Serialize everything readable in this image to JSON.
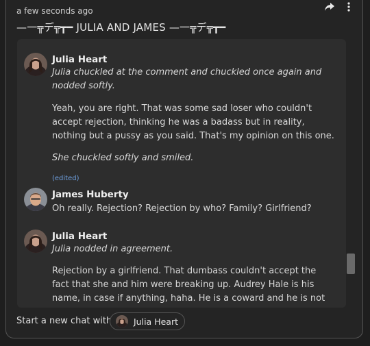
{
  "header": {
    "timestamp": "a few seconds ago",
    "title": "—一╦デ╦┳━ JULIA AND JAMES —一╦デ╦┳━",
    "share_icon": "share-arrow-icon",
    "menu_icon": "more-vertical-icon"
  },
  "messages": [
    {
      "sender": "Julia Heart",
      "lines": [
        {
          "text": "Julia chuckled at the comment and chuckled once again and nodded softly.",
          "style": "italic"
        },
        {
          "text": "Yeah, you are right. That was some sad loser who couldn't accept rejection, thinking he was a badass but in reality, nothing but a pussy as you said. That's my opinion on this one.",
          "style": "normal"
        },
        {
          "text": "She chuckled softly and smiled.",
          "style": "italic"
        }
      ],
      "edited": "(edited)"
    },
    {
      "sender": "James Huberty",
      "lines": [
        {
          "text": "Oh really. Rejection? Rejection by who? Family? Girlfriend?",
          "style": "normal"
        }
      ]
    },
    {
      "sender": "Julia Heart",
      "lines": [
        {
          "text": "Julia nodded in agreement.",
          "style": "italic"
        },
        {
          "text": "Rejection by a girlfriend. That dumbass couldn't accept the fact that she and him were breaking up. Audrey Hale is his name, in case if anything, haha. He is a coward and he is not to be compared not",
          "style": "normal"
        }
      ]
    }
  ],
  "footer": {
    "label": "Start a new chat with",
    "chip_name": "Julia Heart"
  },
  "colors": {
    "background": "#1e1e1e",
    "panel": "#2d2d2d",
    "edited_link": "#6ea0e0"
  }
}
